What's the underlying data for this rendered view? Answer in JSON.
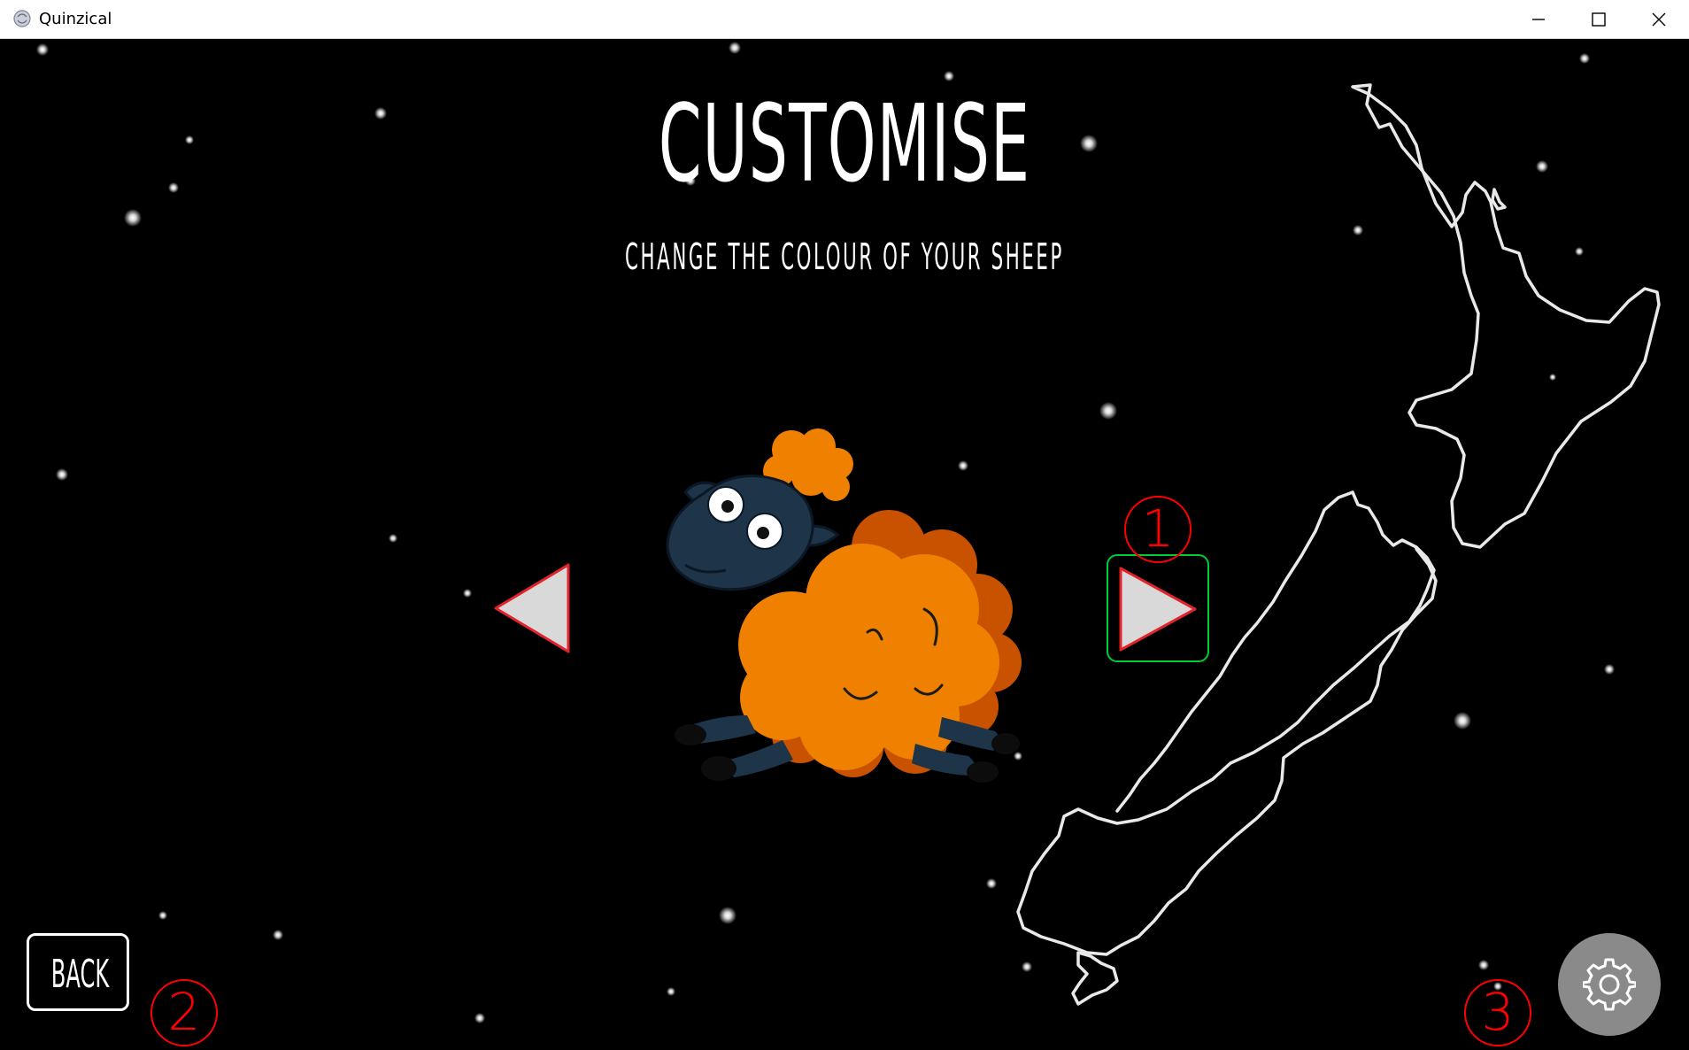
{
  "window": {
    "title": "Quinzical"
  },
  "screen": {
    "title": "CUSTOMISE",
    "subtitle": "CHANGE THE COLOUR OF YOUR SHEEP"
  },
  "sheep": {
    "wool_color": "#f08000",
    "face_color": "#1e3448"
  },
  "controls": {
    "previous_icon": "left-triangle-icon",
    "next_icon": "right-triangle-icon",
    "back_label": "BACK",
    "settings_icon": "gear-icon"
  },
  "annotations": {
    "marker_1": "1",
    "marker_2": "2",
    "marker_3": "3"
  },
  "colors": {
    "background": "#000000",
    "accent_selected": "#00cc33",
    "annotation": "#ff0000",
    "arrow_fill": "#d9d9d9"
  }
}
